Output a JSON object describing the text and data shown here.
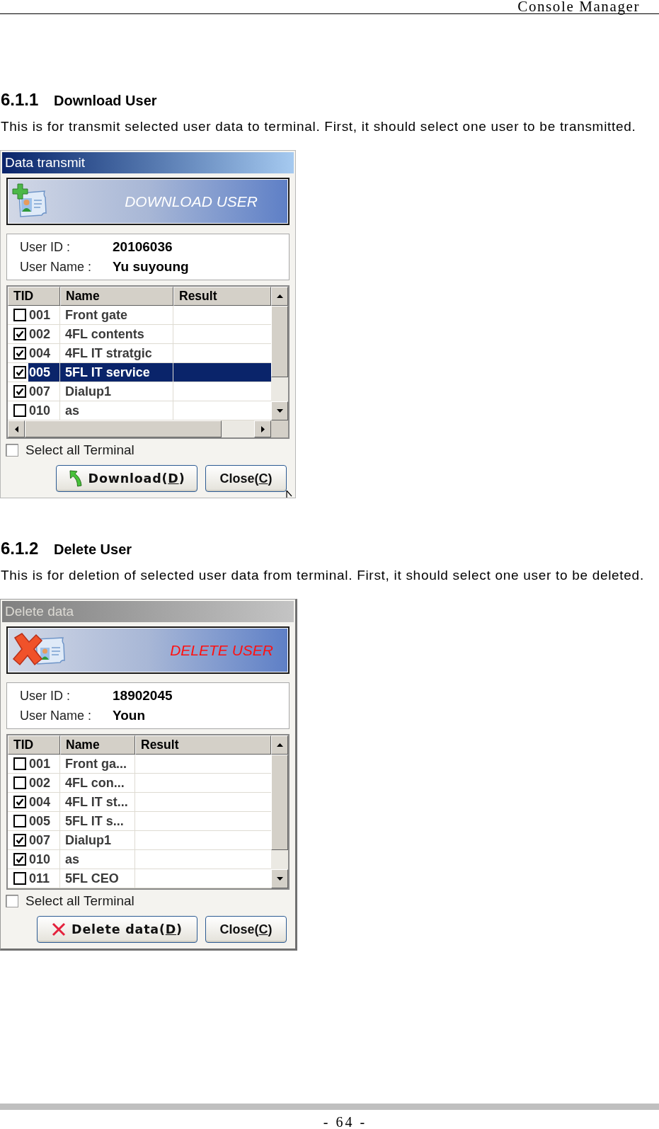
{
  "header": {
    "title": "Console Manager"
  },
  "sections": [
    {
      "number": "6.1.1",
      "title": "Download User",
      "description": "This is for transmit selected user data to terminal. First, it should select one user to be transmitted.",
      "dialog": {
        "kind": "download",
        "title": "Data transmit",
        "active": true,
        "banner": "DOWNLOAD USER",
        "fields": [
          {
            "label": "User ID :",
            "value": "20106036"
          },
          {
            "label": "User Name :",
            "value": "Yu suyoung"
          }
        ],
        "columns": [
          "TID",
          "Name",
          "Result"
        ],
        "rows": [
          {
            "tid": "001",
            "name": "Front gate",
            "checked": false,
            "selected": false
          },
          {
            "tid": "002",
            "name": "4FL contents",
            "checked": true,
            "selected": false
          },
          {
            "tid": "004",
            "name": "4FL IT stratgic",
            "checked": true,
            "selected": false
          },
          {
            "tid": "005",
            "name": "5FL IT service",
            "checked": true,
            "selected": true
          },
          {
            "tid": "007",
            "name": "Dialup1",
            "checked": true,
            "selected": false
          },
          {
            "tid": "010",
            "name": "as",
            "checked": false,
            "selected": false
          }
        ],
        "horizontal_scrollbar": true,
        "select_all": {
          "label": "Select all Terminal",
          "checked": false
        },
        "buttons": [
          {
            "kind": "download",
            "label_start": "Download(",
            "mnemonic": "D",
            "label_end": ")"
          },
          {
            "kind": "close",
            "label_start": "Close(",
            "mnemonic": "C",
            "label_end": ")"
          }
        ],
        "pointer": true
      }
    },
    {
      "number": "6.1.2",
      "title": "Delete User",
      "description": "This is for deletion of selected user data from terminal. First, it should select one user to be deleted.",
      "dialog": {
        "kind": "delete",
        "title": "Delete data",
        "active": false,
        "banner": "DELETE USER",
        "fields": [
          {
            "label": "User ID :",
            "value": "18902045"
          },
          {
            "label": "User Name :",
            "value": "Youn"
          }
        ],
        "columns": [
          "TID",
          "Name",
          "Result"
        ],
        "rows": [
          {
            "tid": "001",
            "name": "Front ga...",
            "checked": false,
            "selected": false
          },
          {
            "tid": "002",
            "name": "4FL con...",
            "checked": false,
            "selected": false
          },
          {
            "tid": "004",
            "name": "4FL IT st...",
            "checked": true,
            "selected": false
          },
          {
            "tid": "005",
            "name": "5FL IT s...",
            "checked": false,
            "selected": false
          },
          {
            "tid": "007",
            "name": "Dialup1",
            "checked": true,
            "selected": false
          },
          {
            "tid": "010",
            "name": "as",
            "checked": true,
            "selected": false
          },
          {
            "tid": "011",
            "name": "5FL CEO",
            "checked": false,
            "selected": false
          }
        ],
        "select_all": {
          "label": "Select all Terminal",
          "checked": false
        },
        "buttons": [
          {
            "kind": "delete",
            "label_start": "Delete data(",
            "mnemonic": "D",
            "label_end": ")"
          },
          {
            "kind": "close",
            "label_start": "Close(",
            "mnemonic": "C",
            "label_end": ")"
          }
        ]
      }
    }
  ],
  "footer": {
    "page": "- 64 -"
  }
}
